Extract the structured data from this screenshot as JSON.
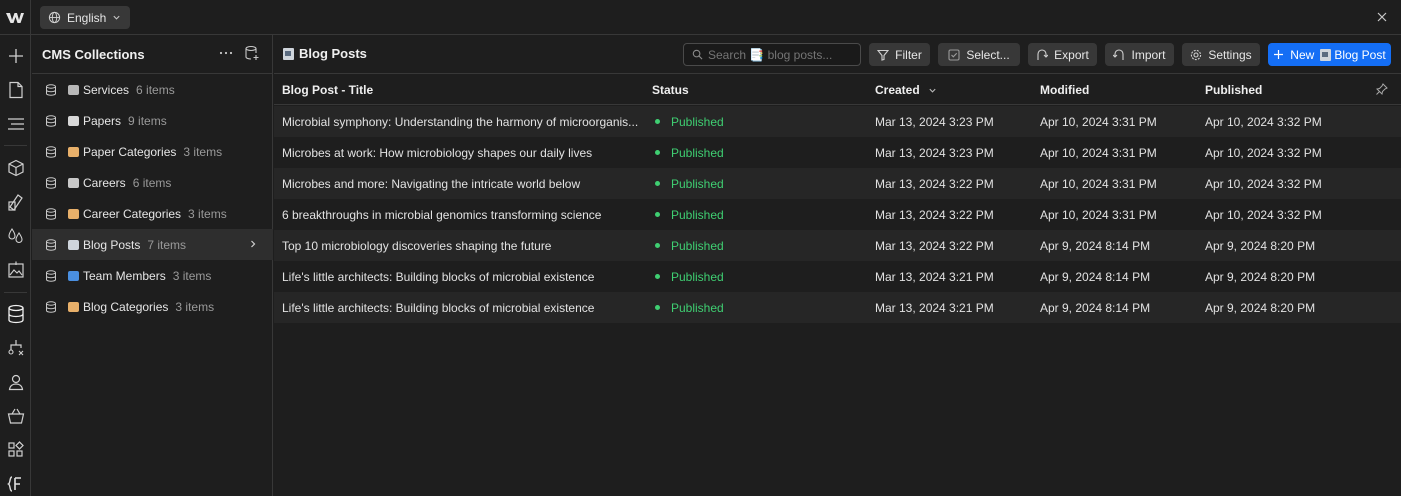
{
  "topbar": {
    "language": "English",
    "logo_icon": "webflow-logo-icon"
  },
  "collections": {
    "title": "CMS Collections",
    "items": [
      {
        "name": "Services",
        "count": "6 items",
        "emoji_color": "#b8b8b8"
      },
      {
        "name": "Papers",
        "count": "9 items",
        "emoji_color": "#d8d8d8"
      },
      {
        "name": "Paper Categories",
        "count": "3 items",
        "emoji_color": "#e8b06a"
      },
      {
        "name": "Careers",
        "count": "6 items",
        "emoji_color": "#c8c8c8"
      },
      {
        "name": "Career Categories",
        "count": "3 items",
        "emoji_color": "#e8b06a"
      },
      {
        "name": "Blog Posts",
        "count": "7 items",
        "emoji_color": "#cfd5dc"
      },
      {
        "name": "Team Members",
        "count": "3 items",
        "emoji_color": "#4a8fe0"
      },
      {
        "name": "Blog Categories",
        "count": "3 items",
        "emoji_color": "#e8b06a"
      }
    ],
    "active_index": 5
  },
  "main": {
    "title": "Blog Posts",
    "search_placeholder": "Search 📑 blog posts...",
    "buttons": {
      "filter": "Filter",
      "select": "Select...",
      "export": "Export",
      "import": "Import",
      "settings": "Settings",
      "new": "New",
      "new_suffix": "Blog Post"
    },
    "columns": {
      "title": "Blog Post - Title",
      "status": "Status",
      "created": "Created",
      "modified": "Modified",
      "published": "Published"
    },
    "rows": [
      {
        "title": "Microbial symphony: Understanding the harmony of microorganis...",
        "status": "Published",
        "created": "Mar 13, 2024 3:23 PM",
        "modified": "Apr 10, 2024 3:31 PM",
        "published": "Apr 10, 2024 3:32 PM"
      },
      {
        "title": "Microbes at work: How microbiology shapes our daily lives",
        "status": "Published",
        "created": "Mar 13, 2024 3:23 PM",
        "modified": "Apr 10, 2024 3:31 PM",
        "published": "Apr 10, 2024 3:32 PM"
      },
      {
        "title": "Microbes and more: Navigating the intricate world below",
        "status": "Published",
        "created": "Mar 13, 2024 3:22 PM",
        "modified": "Apr 10, 2024 3:31 PM",
        "published": "Apr 10, 2024 3:32 PM"
      },
      {
        "title": "6 breakthroughs in microbial genomics transforming science",
        "status": "Published",
        "created": "Mar 13, 2024 3:22 PM",
        "modified": "Apr 10, 2024 3:31 PM",
        "published": "Apr 10, 2024 3:32 PM"
      },
      {
        "title": "Top 10 microbiology discoveries shaping the future",
        "status": "Published",
        "created": "Mar 13, 2024 3:22 PM",
        "modified": "Apr 9, 2024 8:14 PM",
        "published": "Apr 9, 2024 8:20 PM"
      },
      {
        "title": "Life's little architects: Building blocks of microbial existence",
        "status": "Published",
        "created": "Mar 13, 2024 3:21 PM",
        "modified": "Apr 9, 2024 8:14 PM",
        "published": "Apr 9, 2024 8:20 PM"
      },
      {
        "title": "Life's little architects: Building blocks of microbial existence",
        "status": "Published",
        "created": "Mar 13, 2024 3:21 PM",
        "modified": "Apr 9, 2024 8:14 PM",
        "published": "Apr 9, 2024 8:20 PM"
      }
    ]
  },
  "colors": {
    "accent": "#146ef5",
    "published": "#3fcf72"
  },
  "rail_icons": [
    "add-icon",
    "pages-icon",
    "navigator-icon",
    "components-icon",
    "style-selectors-icon",
    "variables-icon",
    "assets-icon",
    "cms-icon",
    "logic-icon",
    "users-icon",
    "ecommerce-icon",
    "apps-icon",
    "code-icon"
  ]
}
